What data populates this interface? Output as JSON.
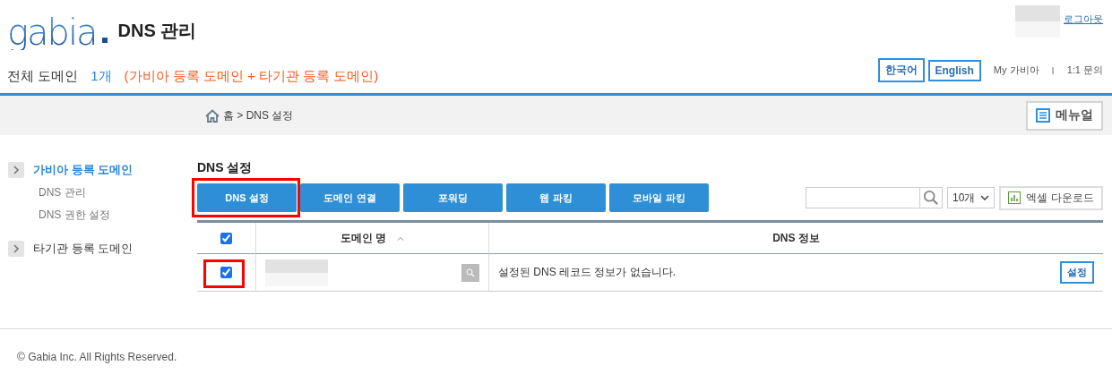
{
  "logo": {
    "text": "gabia"
  },
  "page_title": "DNS 관리",
  "logout": "로그아웃",
  "summary": {
    "label": "전체 도메인",
    "count": "1개",
    "note": "(가비아 등록 도메인 + 타기관 등록 도메인)"
  },
  "languages": [
    {
      "label": "한국어"
    },
    {
      "label": "English"
    }
  ],
  "top_links": [
    {
      "label": "My 가비아"
    },
    {
      "label": "1:1 문의"
    }
  ],
  "link_separator": "I",
  "breadcrumb": "홈 > DNS 설정",
  "manual_button": "메뉴얼",
  "sidebar": [
    {
      "label": "가비아 등록 도메인",
      "selected": true,
      "children": [
        {
          "label": "DNS 관리"
        },
        {
          "label": "DNS 권한 설정"
        }
      ]
    },
    {
      "label": "타기관 등록 도메인",
      "selected": false
    }
  ],
  "section_title": "DNS 설정",
  "tabs": [
    {
      "label": "DNS 설정",
      "highlighted": true
    },
    {
      "label": "도메인 연결",
      "highlighted": false
    },
    {
      "label": "포워딩",
      "highlighted": false
    },
    {
      "label": "웹 파킹",
      "highlighted": false
    },
    {
      "label": "모바일 파킹",
      "highlighted": false
    }
  ],
  "page_size": "10개",
  "excel_button": "엑셀 다운로드",
  "table": {
    "header_checked": true,
    "columns": [
      {
        "label": "도메인 명",
        "sorted": true
      },
      {
        "label": "DNS 정보"
      }
    ],
    "rows": [
      {
        "checked": true,
        "highlighted": true,
        "info": "설정된 DNS 레코드 정보가 없습니다.",
        "action": "설정"
      }
    ]
  },
  "footer": "© Gabia Inc. All Rights Reserved."
}
